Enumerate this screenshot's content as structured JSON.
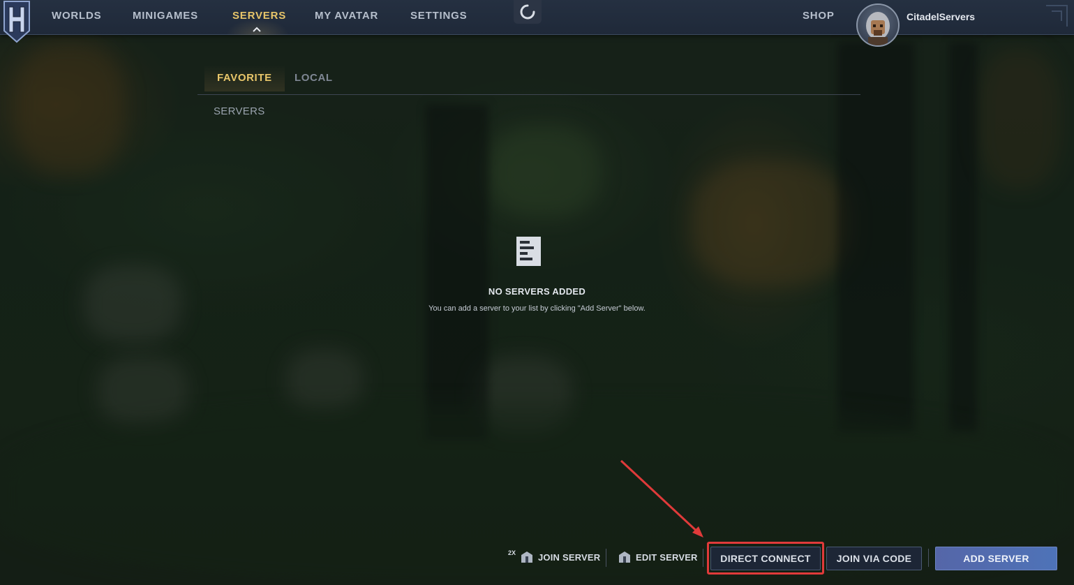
{
  "nav": {
    "items": [
      {
        "label": "WORLDS"
      },
      {
        "label": "MINIGAMES"
      },
      {
        "label": "SERVERS"
      },
      {
        "label": "MY AVATAR"
      },
      {
        "label": "SETTINGS"
      }
    ],
    "active": "SERVERS",
    "shop_label": "SHOP",
    "username": "CitadelServers",
    "logo_letter": "H"
  },
  "tabs": [
    {
      "label": "FAVORITE",
      "active": true
    },
    {
      "label": "LOCAL",
      "active": false
    }
  ],
  "section_title": "SERVERS",
  "empty_state": {
    "icon": "document-list-icon",
    "title": "NO SERVERS ADDED",
    "description": "You can add a server to your list by clicking \"Add Server\" below."
  },
  "actions": {
    "join_modifier": "2X",
    "join_server": "JOIN SERVER",
    "edit_server": "EDIT SERVER",
    "direct_connect": "DIRECT CONNECT",
    "join_via_code": "JOIN VIA CODE",
    "add_server": "ADD SERVER"
  },
  "colors": {
    "accent_gold": "#e8c66a",
    "primary_button": "#4e73b8",
    "highlight_red": "#e03a3a"
  }
}
